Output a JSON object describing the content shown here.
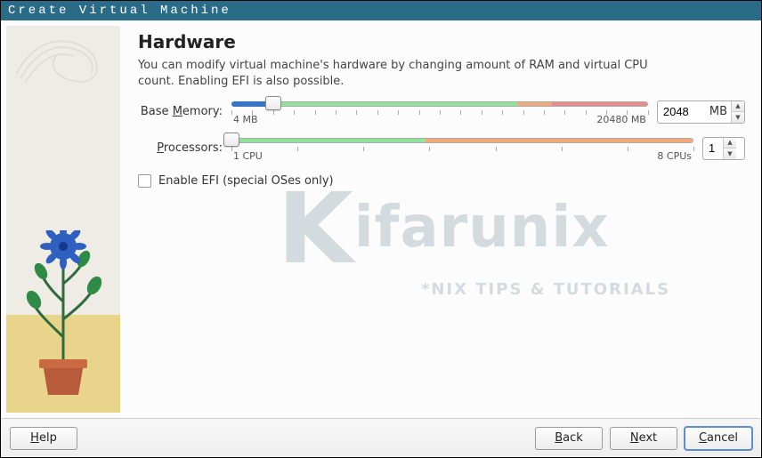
{
  "window": {
    "title": "Create Virtual Machine"
  },
  "page": {
    "heading": "Hardware",
    "description": "You can modify virtual machine's hardware by changing amount of RAM and virtual CPU count. Enabling EFI is also possible."
  },
  "memory": {
    "label_pre": "Base ",
    "label_ul": "M",
    "label_post": "emory:",
    "min_label": "4 MB",
    "max_label": "20480 MB",
    "value": "2048",
    "unit": "MB",
    "green_pct": 69,
    "orange_end_pct": 77,
    "fill_pct": 10,
    "handle_pct": 10
  },
  "cpu": {
    "label_ul": "P",
    "label_post": "rocessors:",
    "min_label": "1 CPU",
    "max_label": "8 CPUs",
    "value": "1",
    "green_pct": 42,
    "orange_end_pct": 100,
    "handle_pct": 0
  },
  "efi": {
    "label_ul": "E",
    "label_post": "nable EFI (special OSes only)",
    "checked": false
  },
  "buttons": {
    "help_ul": "H",
    "help_post": "elp",
    "back_ul": "B",
    "back_post": "ack",
    "next_ul": "N",
    "next_post": "ext",
    "cancel_ul": "C",
    "cancel_post": "ancel"
  },
  "watermark": {
    "main": "ifarunix",
    "sub": "*NIX TIPS & TUTORIALS"
  }
}
